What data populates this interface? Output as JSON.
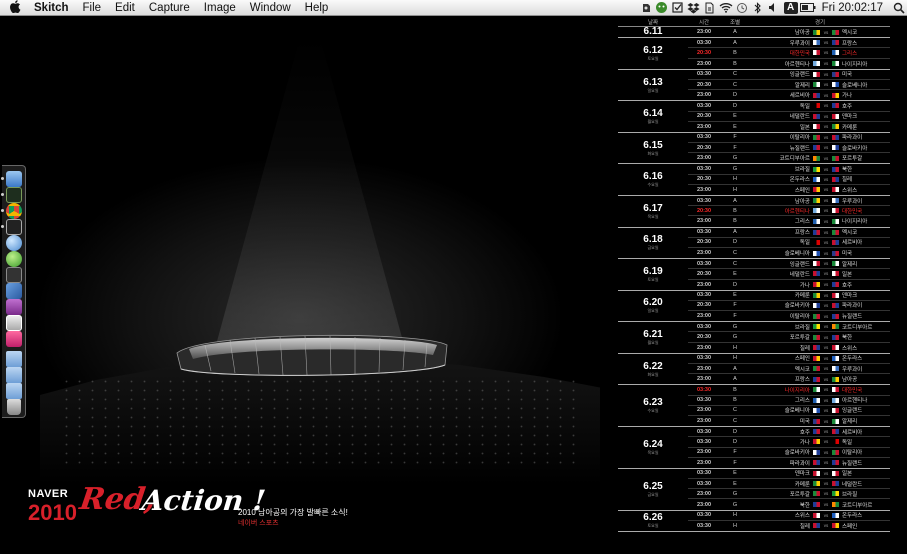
{
  "menubar": {
    "app_name": "Skitch",
    "menus": [
      "File",
      "Edit",
      "Capture",
      "Image",
      "Window",
      "Help"
    ],
    "clock": "Fri 20:02:17",
    "status_icons": [
      "evernote-icon",
      "chat-icon",
      "checkbox-icon",
      "dropbox-icon",
      "sync-icon",
      "wifi-icon",
      "time-machine-icon",
      "bluetooth-icon",
      "volume-icon",
      "input-source-icon",
      "battery-icon",
      "spotlight-icon"
    ],
    "input_source_label": "A"
  },
  "branding": {
    "naver": "NAVER",
    "year": "2010",
    "red": "Red,",
    "action": "Action !",
    "tagline": "2010 남아공의 가장 발빠른 소식!",
    "sub": "네이버 스포츠"
  },
  "dock": {
    "items": [
      "finder-icon",
      "terminal-icon",
      "chrome-icon",
      "console-icon",
      "network-icon",
      "adium-icon",
      "activity-monitor-icon",
      "virtualbox-icon",
      "preview-icon",
      "photo-icon",
      "airmail-icon",
      "folder-icon",
      "documents-folder-icon",
      "downloads-folder-icon",
      "trash-icon"
    ]
  },
  "schedule": {
    "headers": {
      "date": "날짜",
      "time": "시간",
      "group": "조별",
      "match": "경기"
    },
    "vs": "vs",
    "days": [
      {
        "date": "6.11",
        "dow": "",
        "matches": [
          {
            "time": "23:00",
            "group": "A",
            "home": "남아공",
            "away": "멕시코",
            "hf": [
              "#1a8a3a",
              "#ffcc00"
            ],
            "af": [
              "#1a8a3a",
              "#c8102e"
            ]
          }
        ]
      },
      {
        "date": "6.12",
        "dow": "토요일",
        "matches": [
          {
            "time": "03:30",
            "group": "A",
            "home": "우루과이",
            "away": "프랑스",
            "hf": [
              "#ffffff",
              "#3a70c0"
            ],
            "af": [
              "#1e3c96",
              "#c8102e"
            ]
          },
          {
            "time": "20:30",
            "group": "B",
            "home": "대한민국",
            "away": "그리스",
            "hf": [
              "#ffffff",
              "#c8102e"
            ],
            "af": [
              "#2060b0",
              "#ffffff"
            ],
            "hl": true
          },
          {
            "time": "23:00",
            "group": "B",
            "home": "아르헨티나",
            "away": "나이지리아",
            "hf": [
              "#74acdf",
              "#ffffff"
            ],
            "af": [
              "#1a8a3a",
              "#ffffff"
            ]
          }
        ]
      },
      {
        "date": "6.13",
        "dow": "일요일",
        "matches": [
          {
            "time": "03:30",
            "group": "C",
            "home": "잉글랜드",
            "away": "미국",
            "hf": [
              "#ffffff",
              "#c8102e"
            ],
            "af": [
              "#2a3c8a",
              "#c8102e"
            ]
          },
          {
            "time": "20:30",
            "group": "C",
            "home": "알제리",
            "away": "슬로베니아",
            "hf": [
              "#1a8a3a",
              "#ffffff"
            ],
            "af": [
              "#ffffff",
              "#2050b0"
            ]
          },
          {
            "time": "23:00",
            "group": "D",
            "home": "세르비아",
            "away": "가나",
            "hf": [
              "#c8102e",
              "#1e3c96"
            ],
            "af": [
              "#c8102e",
              "#ffcc00"
            ]
          }
        ]
      },
      {
        "date": "6.14",
        "dow": "월요일",
        "matches": [
          {
            "time": "03:30",
            "group": "D",
            "home": "독일",
            "away": "호주",
            "hf": [
              "#000000",
              "#dd0000"
            ],
            "af": [
              "#1e3c96",
              "#c8102e"
            ]
          },
          {
            "time": "20:30",
            "group": "E",
            "home": "네덜란드",
            "away": "덴마크",
            "hf": [
              "#c8102e",
              "#1e3c96"
            ],
            "af": [
              "#c8102e",
              "#ffffff"
            ]
          },
          {
            "time": "23:00",
            "group": "E",
            "home": "일본",
            "away": "카메룬",
            "hf": [
              "#ffffff",
              "#c8102e"
            ],
            "af": [
              "#1a8a3a",
              "#ffcc00"
            ]
          }
        ]
      },
      {
        "date": "6.15",
        "dow": "화요일",
        "matches": [
          {
            "time": "03:30",
            "group": "F",
            "home": "이탈리아",
            "away": "파라과이",
            "hf": [
              "#1a8a3a",
              "#c8102e"
            ],
            "af": [
              "#c8102e",
              "#1e3c96"
            ]
          },
          {
            "time": "20:30",
            "group": "F",
            "home": "뉴질랜드",
            "away": "슬로바키아",
            "hf": [
              "#1e3c96",
              "#c8102e"
            ],
            "af": [
              "#ffffff",
              "#1e3c96"
            ]
          },
          {
            "time": "23:00",
            "group": "G",
            "home": "코트디부아르",
            "away": "포르투갈",
            "hf": [
              "#ff8800",
              "#1a8a3a"
            ],
            "af": [
              "#1a8a3a",
              "#c8102e"
            ]
          }
        ]
      },
      {
        "date": "6.16",
        "dow": "수요일",
        "matches": [
          {
            "time": "03:30",
            "group": "G",
            "home": "브라질",
            "away": "북한",
            "hf": [
              "#1a9a3a",
              "#ffdd00"
            ],
            "af": [
              "#1e3c96",
              "#c8102e"
            ]
          },
          {
            "time": "20:30",
            "group": "H",
            "home": "온두라스",
            "away": "칠레",
            "hf": [
              "#2060c0",
              "#ffffff"
            ],
            "af": [
              "#c8102e",
              "#1e3c96"
            ]
          },
          {
            "time": "23:00",
            "group": "H",
            "home": "스페인",
            "away": "스위스",
            "hf": [
              "#c8102e",
              "#ffcc00"
            ],
            "af": [
              "#c8102e",
              "#ffffff"
            ]
          }
        ]
      },
      {
        "date": "6.17",
        "dow": "목요일",
        "matches": [
          {
            "time": "03:30",
            "group": "A",
            "home": "남아공",
            "away": "우루과이",
            "hf": [
              "#1a8a3a",
              "#ffcc00"
            ],
            "af": [
              "#ffffff",
              "#3a70c0"
            ]
          },
          {
            "time": "20:30",
            "group": "B",
            "home": "아르헨티나",
            "away": "대한민국",
            "hf": [
              "#74acdf",
              "#ffffff"
            ],
            "af": [
              "#ffffff",
              "#c8102e"
            ],
            "hl": true
          },
          {
            "time": "23:00",
            "group": "B",
            "home": "그리스",
            "away": "나이지리아",
            "hf": [
              "#2060b0",
              "#ffffff"
            ],
            "af": [
              "#1a8a3a",
              "#ffffff"
            ]
          }
        ]
      },
      {
        "date": "6.18",
        "dow": "금요일",
        "matches": [
          {
            "time": "03:30",
            "group": "A",
            "home": "프랑스",
            "away": "멕시코",
            "hf": [
              "#1e3c96",
              "#c8102e"
            ],
            "af": [
              "#1a8a3a",
              "#c8102e"
            ]
          },
          {
            "time": "20:30",
            "group": "D",
            "home": "독일",
            "away": "세르비아",
            "hf": [
              "#000000",
              "#dd0000"
            ],
            "af": [
              "#c8102e",
              "#1e3c96"
            ]
          },
          {
            "time": "23:00",
            "group": "C",
            "home": "슬로베니아",
            "away": "미국",
            "hf": [
              "#ffffff",
              "#2050b0"
            ],
            "af": [
              "#2a3c8a",
              "#c8102e"
            ]
          }
        ]
      },
      {
        "date": "6.19",
        "dow": "토요일",
        "matches": [
          {
            "time": "03:30",
            "group": "C",
            "home": "잉글랜드",
            "away": "알제리",
            "hf": [
              "#ffffff",
              "#c8102e"
            ],
            "af": [
              "#1a8a3a",
              "#ffffff"
            ]
          },
          {
            "time": "20:30",
            "group": "E",
            "home": "네덜란드",
            "away": "일본",
            "hf": [
              "#c8102e",
              "#1e3c96"
            ],
            "af": [
              "#ffffff",
              "#c8102e"
            ]
          },
          {
            "time": "23:00",
            "group": "D",
            "home": "가나",
            "away": "호주",
            "hf": [
              "#c8102e",
              "#ffcc00"
            ],
            "af": [
              "#1e3c96",
              "#c8102e"
            ]
          }
        ]
      },
      {
        "date": "6.20",
        "dow": "일요일",
        "matches": [
          {
            "time": "03:30",
            "group": "E",
            "home": "카메룬",
            "away": "덴마크",
            "hf": [
              "#1a8a3a",
              "#ffcc00"
            ],
            "af": [
              "#c8102e",
              "#ffffff"
            ]
          },
          {
            "time": "20:30",
            "group": "F",
            "home": "슬로바키아",
            "away": "파라과이",
            "hf": [
              "#ffffff",
              "#1e3c96"
            ],
            "af": [
              "#c8102e",
              "#1e3c96"
            ]
          },
          {
            "time": "23:00",
            "group": "F",
            "home": "이탈리아",
            "away": "뉴질랜드",
            "hf": [
              "#1a8a3a",
              "#c8102e"
            ],
            "af": [
              "#1e3c96",
              "#c8102e"
            ]
          }
        ]
      },
      {
        "date": "6.21",
        "dow": "월요일",
        "matches": [
          {
            "time": "03:30",
            "group": "G",
            "home": "브라질",
            "away": "코트디부아르",
            "hf": [
              "#1a9a3a",
              "#ffdd00"
            ],
            "af": [
              "#ff8800",
              "#1a8a3a"
            ]
          },
          {
            "time": "20:30",
            "group": "G",
            "home": "포르투갈",
            "away": "북한",
            "hf": [
              "#1a8a3a",
              "#c8102e"
            ],
            "af": [
              "#1e3c96",
              "#c8102e"
            ]
          },
          {
            "time": "23:00",
            "group": "H",
            "home": "칠레",
            "away": "스위스",
            "hf": [
              "#c8102e",
              "#1e3c96"
            ],
            "af": [
              "#c8102e",
              "#ffffff"
            ]
          }
        ]
      },
      {
        "date": "6.22",
        "dow": "화요일",
        "matches": [
          {
            "time": "03:30",
            "group": "H",
            "home": "스페인",
            "away": "온두라스",
            "hf": [
              "#c8102e",
              "#ffcc00"
            ],
            "af": [
              "#2060c0",
              "#ffffff"
            ]
          },
          {
            "time": "23:00",
            "group": "A",
            "home": "멕시코",
            "away": "우루과이",
            "hf": [
              "#1a8a3a",
              "#c8102e"
            ],
            "af": [
              "#ffffff",
              "#3a70c0"
            ]
          },
          {
            "time": "23:00",
            "group": "A",
            "home": "프랑스",
            "away": "남아공",
            "hf": [
              "#1e3c96",
              "#c8102e"
            ],
            "af": [
              "#1a8a3a",
              "#ffcc00"
            ]
          }
        ]
      },
      {
        "date": "6.23",
        "dow": "수요일",
        "matches": [
          {
            "time": "03:30",
            "group": "B",
            "home": "나이지리아",
            "away": "대한민국",
            "hf": [
              "#1a8a3a",
              "#ffffff"
            ],
            "af": [
              "#ffffff",
              "#c8102e"
            ],
            "hl": true
          },
          {
            "time": "03:30",
            "group": "B",
            "home": "그리스",
            "away": "아르헨티나",
            "hf": [
              "#2060b0",
              "#ffffff"
            ],
            "af": [
              "#74acdf",
              "#ffffff"
            ]
          },
          {
            "time": "23:00",
            "group": "C",
            "home": "슬로베니아",
            "away": "잉글랜드",
            "hf": [
              "#ffffff",
              "#2050b0"
            ],
            "af": [
              "#ffffff",
              "#c8102e"
            ]
          },
          {
            "time": "23:00",
            "group": "C",
            "home": "미국",
            "away": "알제리",
            "hf": [
              "#2a3c8a",
              "#c8102e"
            ],
            "af": [
              "#1a8a3a",
              "#ffffff"
            ]
          }
        ]
      },
      {
        "date": "6.24",
        "dow": "목요일",
        "matches": [
          {
            "time": "03:30",
            "group": "D",
            "home": "호주",
            "away": "세르비아",
            "hf": [
              "#1e3c96",
              "#c8102e"
            ],
            "af": [
              "#c8102e",
              "#1e3c96"
            ]
          },
          {
            "time": "03:30",
            "group": "D",
            "home": "가나",
            "away": "독일",
            "hf": [
              "#c8102e",
              "#ffcc00"
            ],
            "af": [
              "#000000",
              "#dd0000"
            ]
          },
          {
            "time": "23:00",
            "group": "F",
            "home": "슬로바키아",
            "away": "이탈리아",
            "hf": [
              "#ffffff",
              "#1e3c96"
            ],
            "af": [
              "#1a8a3a",
              "#c8102e"
            ]
          },
          {
            "time": "23:00",
            "group": "F",
            "home": "파라과이",
            "away": "뉴질랜드",
            "hf": [
              "#c8102e",
              "#1e3c96"
            ],
            "af": [
              "#1e3c96",
              "#c8102e"
            ]
          }
        ]
      },
      {
        "date": "6.25",
        "dow": "금요일",
        "matches": [
          {
            "time": "03:30",
            "group": "E",
            "home": "덴마크",
            "away": "일본",
            "hf": [
              "#c8102e",
              "#ffffff"
            ],
            "af": [
              "#ffffff",
              "#c8102e"
            ]
          },
          {
            "time": "03:30",
            "group": "E",
            "home": "카메룬",
            "away": "네덜란드",
            "hf": [
              "#1a8a3a",
              "#ffcc00"
            ],
            "af": [
              "#c8102e",
              "#1e3c96"
            ]
          },
          {
            "time": "23:00",
            "group": "G",
            "home": "포르투갈",
            "away": "브라질",
            "hf": [
              "#1a8a3a",
              "#c8102e"
            ],
            "af": [
              "#1a9a3a",
              "#ffdd00"
            ]
          },
          {
            "time": "23:00",
            "group": "G",
            "home": "북한",
            "away": "코트디부아르",
            "hf": [
              "#1e3c96",
              "#c8102e"
            ],
            "af": [
              "#ff8800",
              "#1a8a3a"
            ]
          }
        ]
      },
      {
        "date": "6.26",
        "dow": "토요일",
        "matches": [
          {
            "time": "03:30",
            "group": "H",
            "home": "스위스",
            "away": "온두라스",
            "hf": [
              "#c8102e",
              "#ffffff"
            ],
            "af": [
              "#2060c0",
              "#ffffff"
            ]
          },
          {
            "time": "03:30",
            "group": "H",
            "home": "칠레",
            "away": "스페인",
            "hf": [
              "#c8102e",
              "#1e3c96"
            ],
            "af": [
              "#c8102e",
              "#ffcc00"
            ]
          }
        ]
      }
    ]
  }
}
